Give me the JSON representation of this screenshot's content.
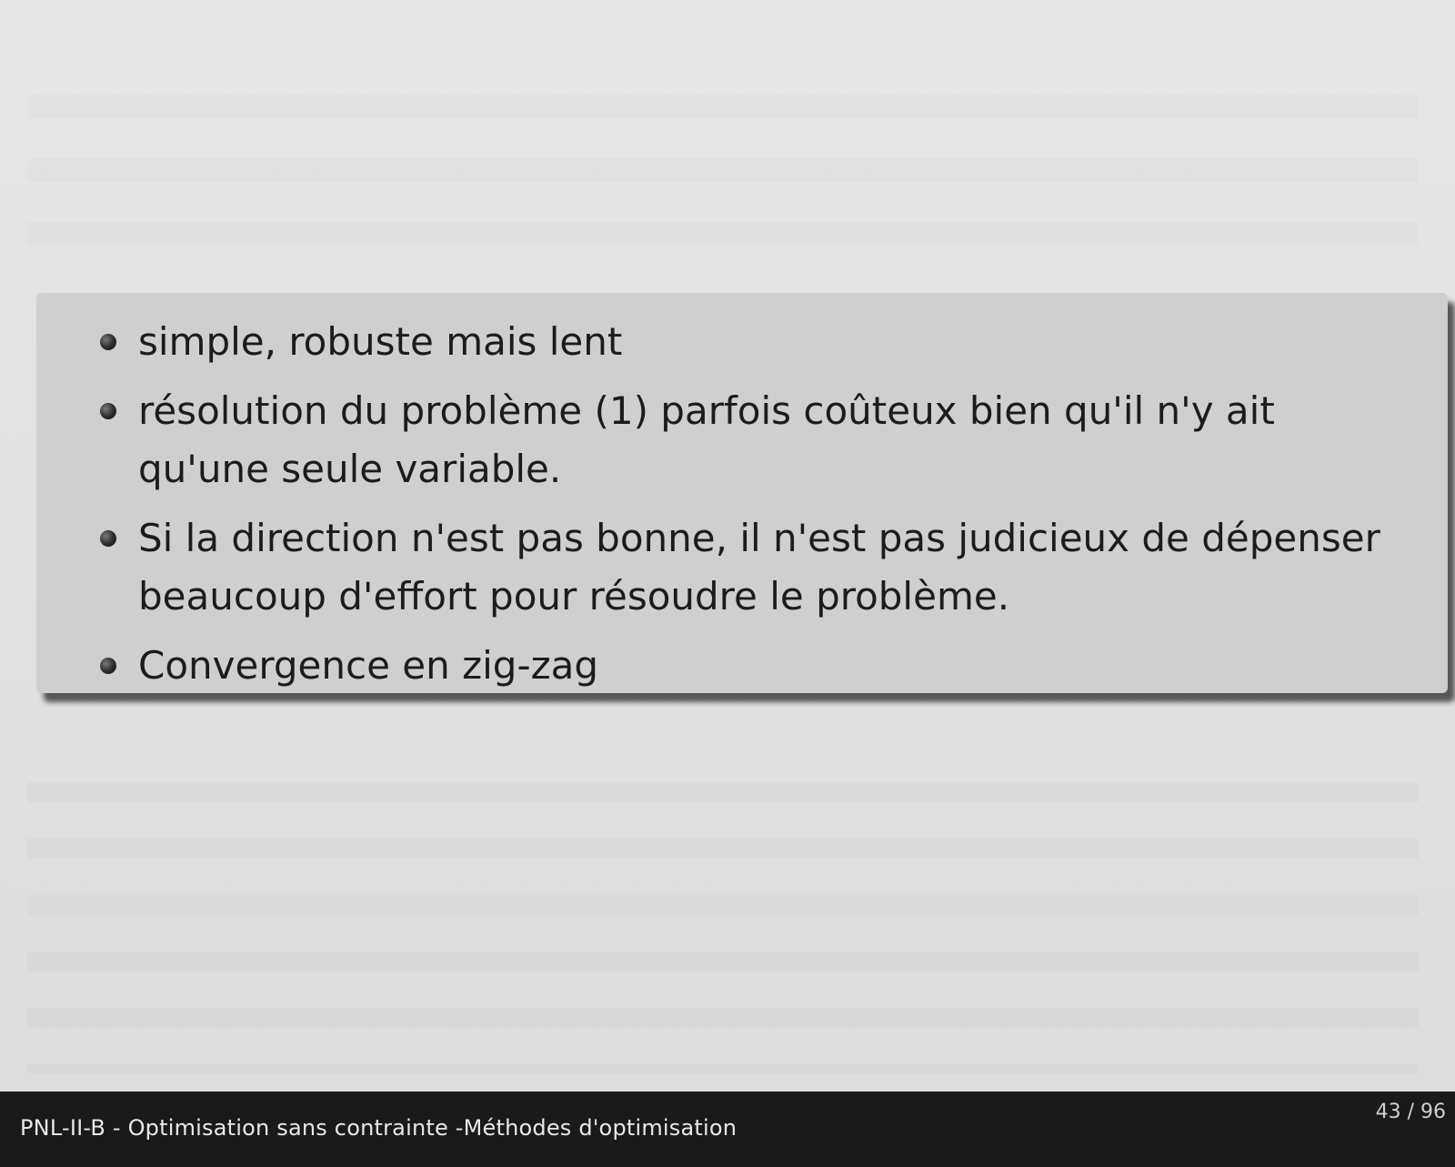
{
  "slide": {
    "bullets": [
      "simple, robuste mais lent",
      "résolution du problème (1) parfois coûteux bien qu'il n'y ait qu'une seule variable.",
      "Si la direction n'est pas bonne, il n'est pas judicieux de dépenser beaucoup d'effort pour résoudre le problème.",
      "Convergence en zig-zag"
    ]
  },
  "footer": {
    "title": "PNL-II-B - Optimisation sans contrainte -Méthodes d'optimisation",
    "page": "43 / 96"
  }
}
